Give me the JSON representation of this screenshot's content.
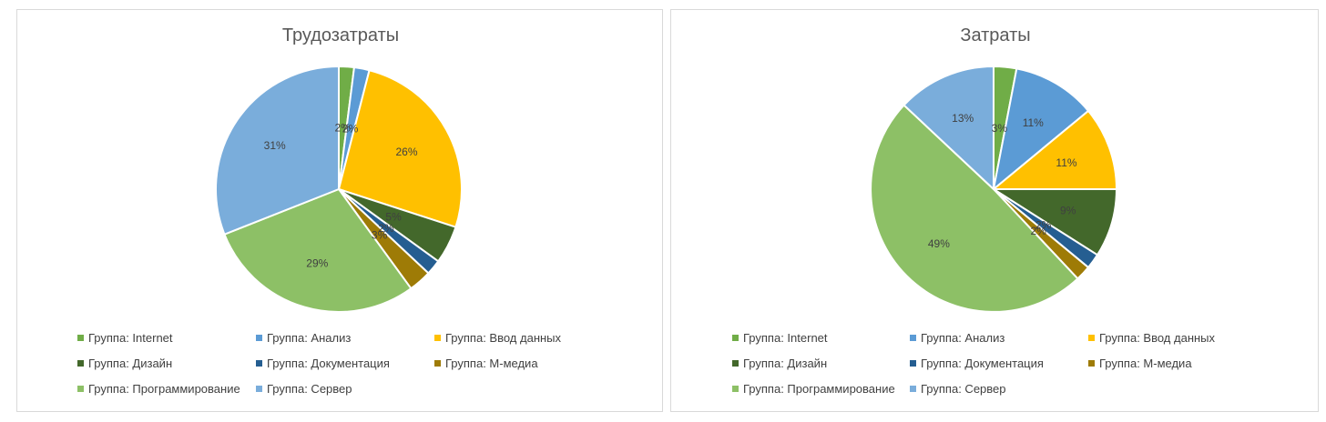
{
  "chart_data": [
    {
      "type": "pie",
      "title": "Трудозатраты",
      "categories": [
        "Группа: Internet",
        "Группа: Анализ",
        "Группа: Ввод данных",
        "Группа: Дизайн",
        "Группа: Документация",
        "Группа: М-медиа",
        "Группа: Программирование",
        "Группа: Сервер"
      ],
      "values": [
        2,
        2,
        26,
        5,
        2,
        3,
        29,
        31
      ],
      "labels": [
        "2%",
        "2%",
        "26%",
        "5%",
        "2%",
        "3%",
        "29%",
        "31%"
      ],
      "colors": [
        "#70ad47",
        "#5b9bd5",
        "#ffc000",
        "#43682b",
        "#255e91",
        "#9e7b06",
        "#8dc066",
        "#7aaddb"
      ],
      "legend_position": "bottom"
    },
    {
      "type": "pie",
      "title": "Затраты",
      "categories": [
        "Группа: Internet",
        "Группа: Анализ",
        "Группа: Ввод данных",
        "Группа: Дизайн",
        "Группа: Документация",
        "Группа: М-медиа",
        "Группа: Программирование",
        "Группа: Сервер"
      ],
      "values": [
        3,
        11,
        11,
        9,
        2,
        2,
        49,
        13
      ],
      "labels": [
        "3%",
        "11%",
        "11%",
        "9%",
        "2%",
        "2%",
        "49%",
        "13%"
      ],
      "colors": [
        "#70ad47",
        "#5b9bd5",
        "#ffc000",
        "#43682b",
        "#255e91",
        "#9e7b06",
        "#8dc066",
        "#7aaddb"
      ],
      "legend_position": "bottom"
    }
  ]
}
